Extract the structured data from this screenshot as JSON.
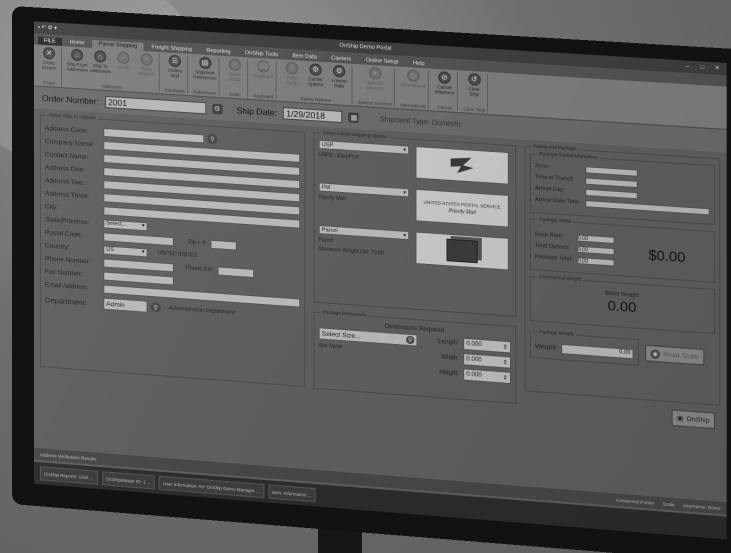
{
  "window": {
    "title": "OnShip Demo Portal",
    "minimize": "–",
    "restore": "□",
    "close": "✕"
  },
  "tabs": [
    "FILE",
    "Home",
    "Parcel Shipping",
    "Freight Shipping",
    "Reporting",
    "OnShip Tools",
    "Item Data",
    "Carriers",
    "Online Setup",
    "Help"
  ],
  "ribbon": {
    "groups": [
      {
        "name": "Close",
        "items": [
          {
            "label": "Close Screen",
            "icon": "✕"
          }
        ]
      },
      {
        "name": "Addresses",
        "items": [
          {
            "label": "Ship From Addresses",
            "icon": "⌂"
          },
          {
            "label": "Ship To Addresses",
            "icon": "⌂"
          },
          {
            "label": "Verify",
            "icon": "✓",
            "dim": true
          },
          {
            "label": "Save Address",
            "icon": "✎",
            "dim": true
          }
        ]
      },
      {
        "name": "Interfaces",
        "items": [
          {
            "label": "Orders Grid",
            "icon": "☰"
          }
        ]
      },
      {
        "name": "References",
        "items": [
          {
            "label": "Shipment References",
            "icon": "▤"
          }
        ]
      },
      {
        "name": "Scale",
        "items": [
          {
            "label": "Scale Setup",
            "icon": "◎",
            "dim": true
          }
        ]
      },
      {
        "name": "Keyboard",
        "items": [
          {
            "label": "Keyboard",
            "icon": "⌨",
            "dim": true
          }
        ]
      },
      {
        "name": "Rating Options",
        "items": [
          {
            "label": "Rate Shop",
            "icon": "$",
            "dim": true
          },
          {
            "label": "Carrier Options",
            "icon": "⚙"
          },
          {
            "label": "Lowest Rate",
            "icon": "⚙"
          }
        ]
      },
      {
        "name": "Special Services",
        "items": [
          {
            "label": "Special Services",
            "icon": "★",
            "dim": true
          }
        ]
      },
      {
        "name": "International",
        "items": [
          {
            "label": "International",
            "icon": "◍",
            "dim": true
          }
        ]
      },
      {
        "name": "Cancel",
        "items": [
          {
            "label": "Cancel Shipment",
            "icon": "⊘"
          }
        ]
      },
      {
        "name": "Clear Ship",
        "items": [
          {
            "label": "Clear Ship",
            "icon": "↺"
          }
        ]
      }
    ]
  },
  "order": {
    "label": "Order Number:",
    "value": "2001",
    "ship_date_label": "Ship Date:",
    "ship_date": "1/29/2018",
    "shipment_type": "Shipment Type: Domestic"
  },
  "ship_to": {
    "title": "Select Ship-To Address",
    "address_code_label": "Address Code:",
    "company_label": "Company Name:",
    "contact_label": "Contact Name:",
    "addr1_label": "Address One:",
    "addr2_label": "Address Two:",
    "addr3_label": "Address Three:",
    "city_label": "City:",
    "state_label": "State/Province:",
    "state_value": "Select...",
    "postal_label": "Postal Code:",
    "zip4_label": "Zip + 4:",
    "country_label": "Country:",
    "country_value": "US",
    "country_name": "UNITED STATES",
    "phone_label": "Phone Number:",
    "phone_ext_label": "Phone Ext.:",
    "fax_label": "Fax Number:",
    "email_label": "Email Address:",
    "dept_label": "Department:",
    "dept_value": "Admin",
    "dept_name": "Administration Department"
  },
  "carrier": {
    "title": "Select Carrier Shipping Options",
    "carrier_value": "USP",
    "carrier_desc": "USPS - EasyPost",
    "service_value": "PM",
    "service_desc": "Priority Mail",
    "service_logo": "Priority Mail",
    "service_logo_brand": "UNITED STATES POSTAL SERVICE",
    "package_value": "Parcel",
    "package_desc": "Parcel",
    "max_weight": "Maximum Weight Lbs:",
    "max_weight_value": "70.00"
  },
  "dimensions": {
    "title": "Package Dimensions",
    "required": "Dimensions Required",
    "select_size": "Select Size...",
    "size_name": "Box Name",
    "length_label": "Length:",
    "length": "0.000",
    "width_label": "Width:",
    "width": "0.000",
    "height_label": "Height:",
    "height": "0.000"
  },
  "rating": {
    "title": "Rating and Package",
    "transit_title": "Package Transit Information",
    "zone_label": "Zone:",
    "time_label": "Time in Transit:",
    "arrival_day_label": "Arrival Day:",
    "arrival_time_label": "Arrival Date Time:",
    "totals_title": "Package Totals",
    "base_rate_label": "Base Rate:",
    "base_rate": "0.00",
    "total_options_label": "Total Options:",
    "total_options": "0.00",
    "package_total_label": "Package Total:",
    "package_total": "0.00",
    "total_big": "$0.00",
    "dim_weight_title": "Dimensional Weight",
    "billed_weight_label": "Billed Weight",
    "billed_weight": "0.00",
    "package_weight_title": "Package Weight",
    "weight_label": "Weight:",
    "weight_value": "0.00",
    "read_scale": "Read Scale",
    "onship": "OnShip"
  },
  "statusbar": {
    "left": "Address Verification Results",
    "right1": "Connected Printer",
    "right2": "Scale",
    "right3": "Username: Demo"
  },
  "taskbar": [
    "OnShip Reports: 1024 ...",
    "OnShipMaster ID: 1 ...",
    "User Information: NY OnShip Demo Manager ...",
    "Item: Information ..."
  ]
}
